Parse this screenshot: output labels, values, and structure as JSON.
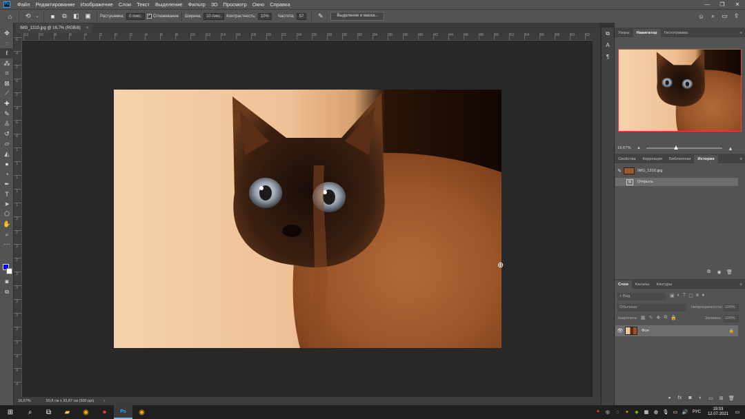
{
  "app": {
    "logo": "Ps",
    "menu": [
      "Файл",
      "Редактирование",
      "Изображение",
      "Слои",
      "Текст",
      "Выделение",
      "Фильтр",
      "3D",
      "Просмотр",
      "Окно",
      "Справка"
    ],
    "window_controls": [
      "—",
      "❐",
      "✕"
    ]
  },
  "options_bar": {
    "feather_label": "Растушевка:",
    "feather_value": "0 пикс.",
    "antialias_label": "Сглаживание",
    "width_label": "Ширина:",
    "width_value": "10 пикс.",
    "contrast_label": "Контрастность:",
    "contrast_value": "10%",
    "frequency_label": "Частота:",
    "frequency_value": "57",
    "select_mask_button": "Выделение и маска..."
  },
  "document": {
    "tab_title": "IMG_1310.jpg @ 16,7% (RGB/8)",
    "close_glyph": "×"
  },
  "ruler": {
    "h_labels": [
      "12",
      "10",
      "8",
      "6",
      "4",
      "2",
      "0",
      "2",
      "4",
      "6",
      "8",
      "10",
      "12",
      "14",
      "16",
      "18",
      "20",
      "22",
      "24",
      "26",
      "28",
      "30",
      "32",
      "34",
      "36",
      "38",
      "40",
      "42",
      "44",
      "46",
      "48",
      "50",
      "52",
      "54",
      "56",
      "58",
      "60",
      "62"
    ],
    "v_labels": [
      "6",
      "4",
      "2",
      "0",
      "2",
      "4",
      "6",
      "8",
      "1",
      "1",
      "1",
      "1",
      "1",
      "2",
      "2",
      "2",
      "2",
      "2",
      "3",
      "3",
      "3",
      "3",
      "3",
      "4",
      "4",
      "4"
    ]
  },
  "status_bar": {
    "zoom": "16,67%",
    "doc_size": "50,8 см x 33,87 см (300 ppi)",
    "arrow": "›"
  },
  "navigator_group": {
    "tabs": [
      "Узоры",
      "Навигатор",
      "Гистограмма"
    ],
    "active_tab": "Навигатор",
    "zoom": "16,67%"
  },
  "history_group": {
    "tabs": [
      "Свойства",
      "Коррекция",
      "Библиотеки",
      "История"
    ],
    "active_tab": "История",
    "snapshot_name": "IMG_1310.jpg",
    "items": [
      "Открыть"
    ]
  },
  "layers_group": {
    "tabs": [
      "Слои",
      "Каналы",
      "Контуры"
    ],
    "active_tab": "Слои",
    "filter_placeholder": "Вид",
    "blend_mode": "Обычные",
    "opacity_label": "Непрозрачность:",
    "opacity_value": "100%",
    "lock_label": "Закрепить:",
    "fill_label": "Заливка:",
    "fill_value": "100%",
    "layers": [
      {
        "name": "Фон",
        "visible": true,
        "locked": true
      }
    ]
  },
  "taskbar": {
    "language": "РУС",
    "time": "19:03",
    "date": "12.07.2021"
  },
  "colors": {
    "foreground": "#0000ff",
    "background": "#ffffff",
    "accent_selection": "#ff3b30"
  }
}
